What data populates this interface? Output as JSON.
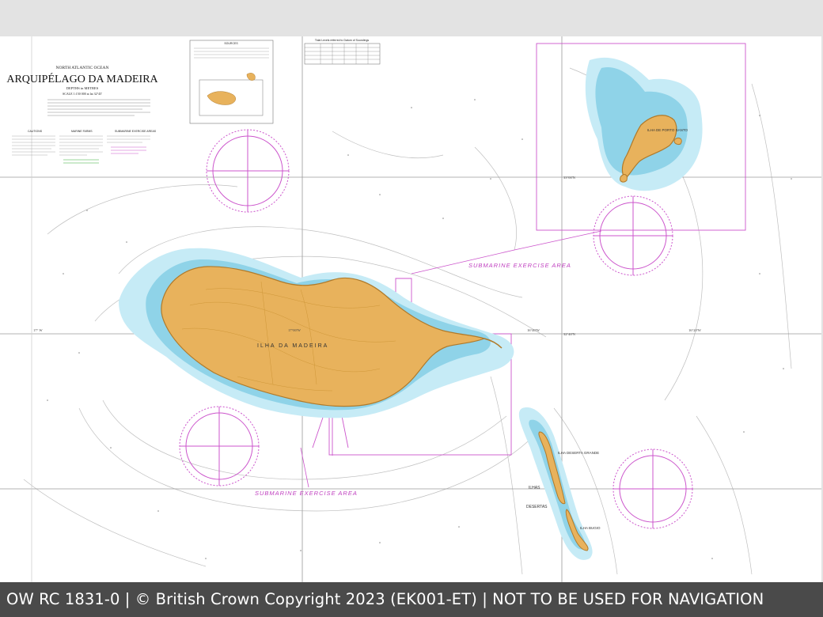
{
  "chart_title": {
    "ocean": "NORTH ATLANTIC OCEAN",
    "name": "ARQUIPÉLAGO DA MADEIRA",
    "depths": "DEPTHS in METRES",
    "scale": "SCALE 1:150 000 at lat 32°45'"
  },
  "notes_headings": [
    "CAUTIONS",
    "MARINE FARMS",
    "SUBMARINE EXERCISE AREAS",
    "SOURCES",
    "Tidal Levels referred to Datum of Soundings"
  ],
  "labels": {
    "island_main": "ILHA DA MADEIRA",
    "ilhas": "ILHAS",
    "desertas": "DESERTAS",
    "deserta_grande": "ILHA DESERTA GRANDE",
    "bugio": "ILHA BUGIO",
    "porto_santo": "ILHA DE PORTO SANTO",
    "sub_area_1": "SUBMARINE  EXERCISE  AREA",
    "sub_area_2": "SUBMARINE  EXERCISE  AREA"
  },
  "grid_labels": [
    "17° W",
    "17°00'W",
    "16°40'W",
    "16°20'W",
    "32°40'N",
    "33°00'N"
  ],
  "colors": {
    "land": "#e8b25c",
    "coast": "#b07a2a",
    "shallow": "#8fd3e8",
    "mid": "#c6ebf6",
    "magenta": "#c040c0",
    "sea": "#ffffff",
    "footer_bg": "#4a4a4a"
  },
  "footer": "OW RC 1831-0 | © British Crown Copyright 2023 (EK001-ET) | NOT TO BE USED FOR NAVIGATION"
}
